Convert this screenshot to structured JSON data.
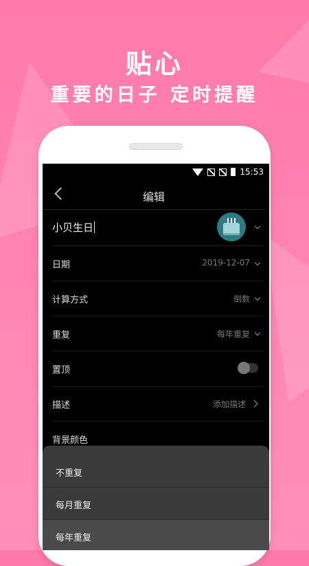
{
  "promo": {
    "headline": "贴心",
    "subheadline": "重要的日子  定时提醒"
  },
  "statusbar": {
    "time": "15:53"
  },
  "app": {
    "title": "编辑",
    "name_value": "小贝生日",
    "rows": {
      "date": {
        "label": "日期",
        "value": "2019-12-07"
      },
      "calc": {
        "label": "计算方式",
        "value": "倒数"
      },
      "repeat": {
        "label": "重复",
        "value": "每年重复"
      },
      "pin": {
        "label": "置顶",
        "toggle_on": false
      },
      "desc": {
        "label": "描述",
        "value": "添加描述"
      },
      "bgcolor": {
        "label": "背景颜色"
      }
    },
    "repeat_sheet": {
      "options": [
        "不重复",
        "每月重复",
        "每年重复"
      ],
      "selected": "每年重复"
    }
  },
  "colors": {
    "background": "#ff7aa8",
    "screen": "#000000",
    "sheet": "#3a3a3a",
    "avatar": "#2e7b84"
  },
  "icons": {
    "back": "chevron-left-icon",
    "avatar": "cake-icon",
    "dropdown": "chevron-down-icon",
    "disclosure": "chevron-right-icon",
    "wifi": "wifi-icon",
    "signal": "no-signal-icon",
    "battery": "battery-icon"
  }
}
